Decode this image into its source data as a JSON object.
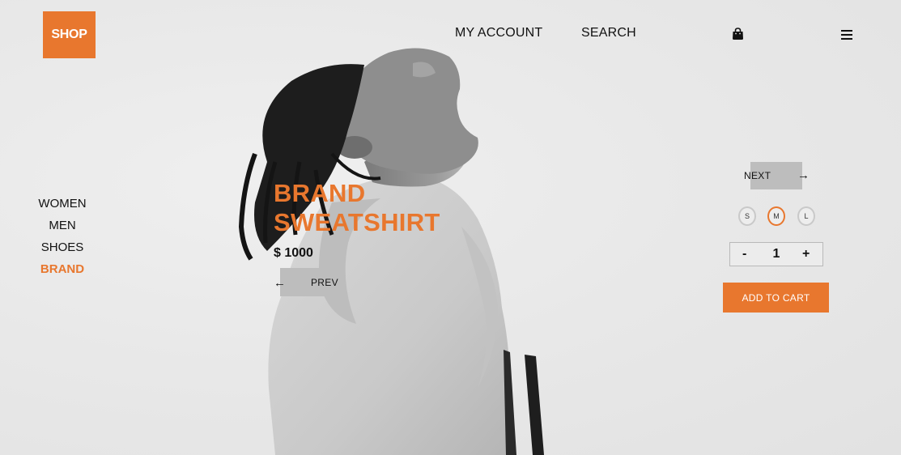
{
  "brand": {
    "logo_text": "SHOP",
    "accent_color": "#e8772e"
  },
  "nav": {
    "account_label": "MY ACCOUNT",
    "search_label": "SEARCH",
    "cart_icon": "shopping-bag-icon",
    "menu_icon": "hamburger-menu-icon"
  },
  "categories": [
    {
      "label": "WOMEN",
      "active": false
    },
    {
      "label": "MEN",
      "active": false
    },
    {
      "label": "SHOES",
      "active": false
    },
    {
      "label": "BRAND",
      "active": true
    }
  ],
  "product": {
    "title_line1": "BRAND",
    "title_line2": "SWEATSHIRT",
    "price": "$ 1000"
  },
  "carousel": {
    "prev_label": "PREV",
    "prev_arrow": "←",
    "next_label": "NEXT",
    "next_arrow": "→"
  },
  "sizes": {
    "options": [
      "S",
      "M",
      "L"
    ],
    "selected": "M"
  },
  "quantity": {
    "minus": "-",
    "value": "1",
    "plus": "+"
  },
  "cart": {
    "add_label": "ADD TO CART"
  }
}
